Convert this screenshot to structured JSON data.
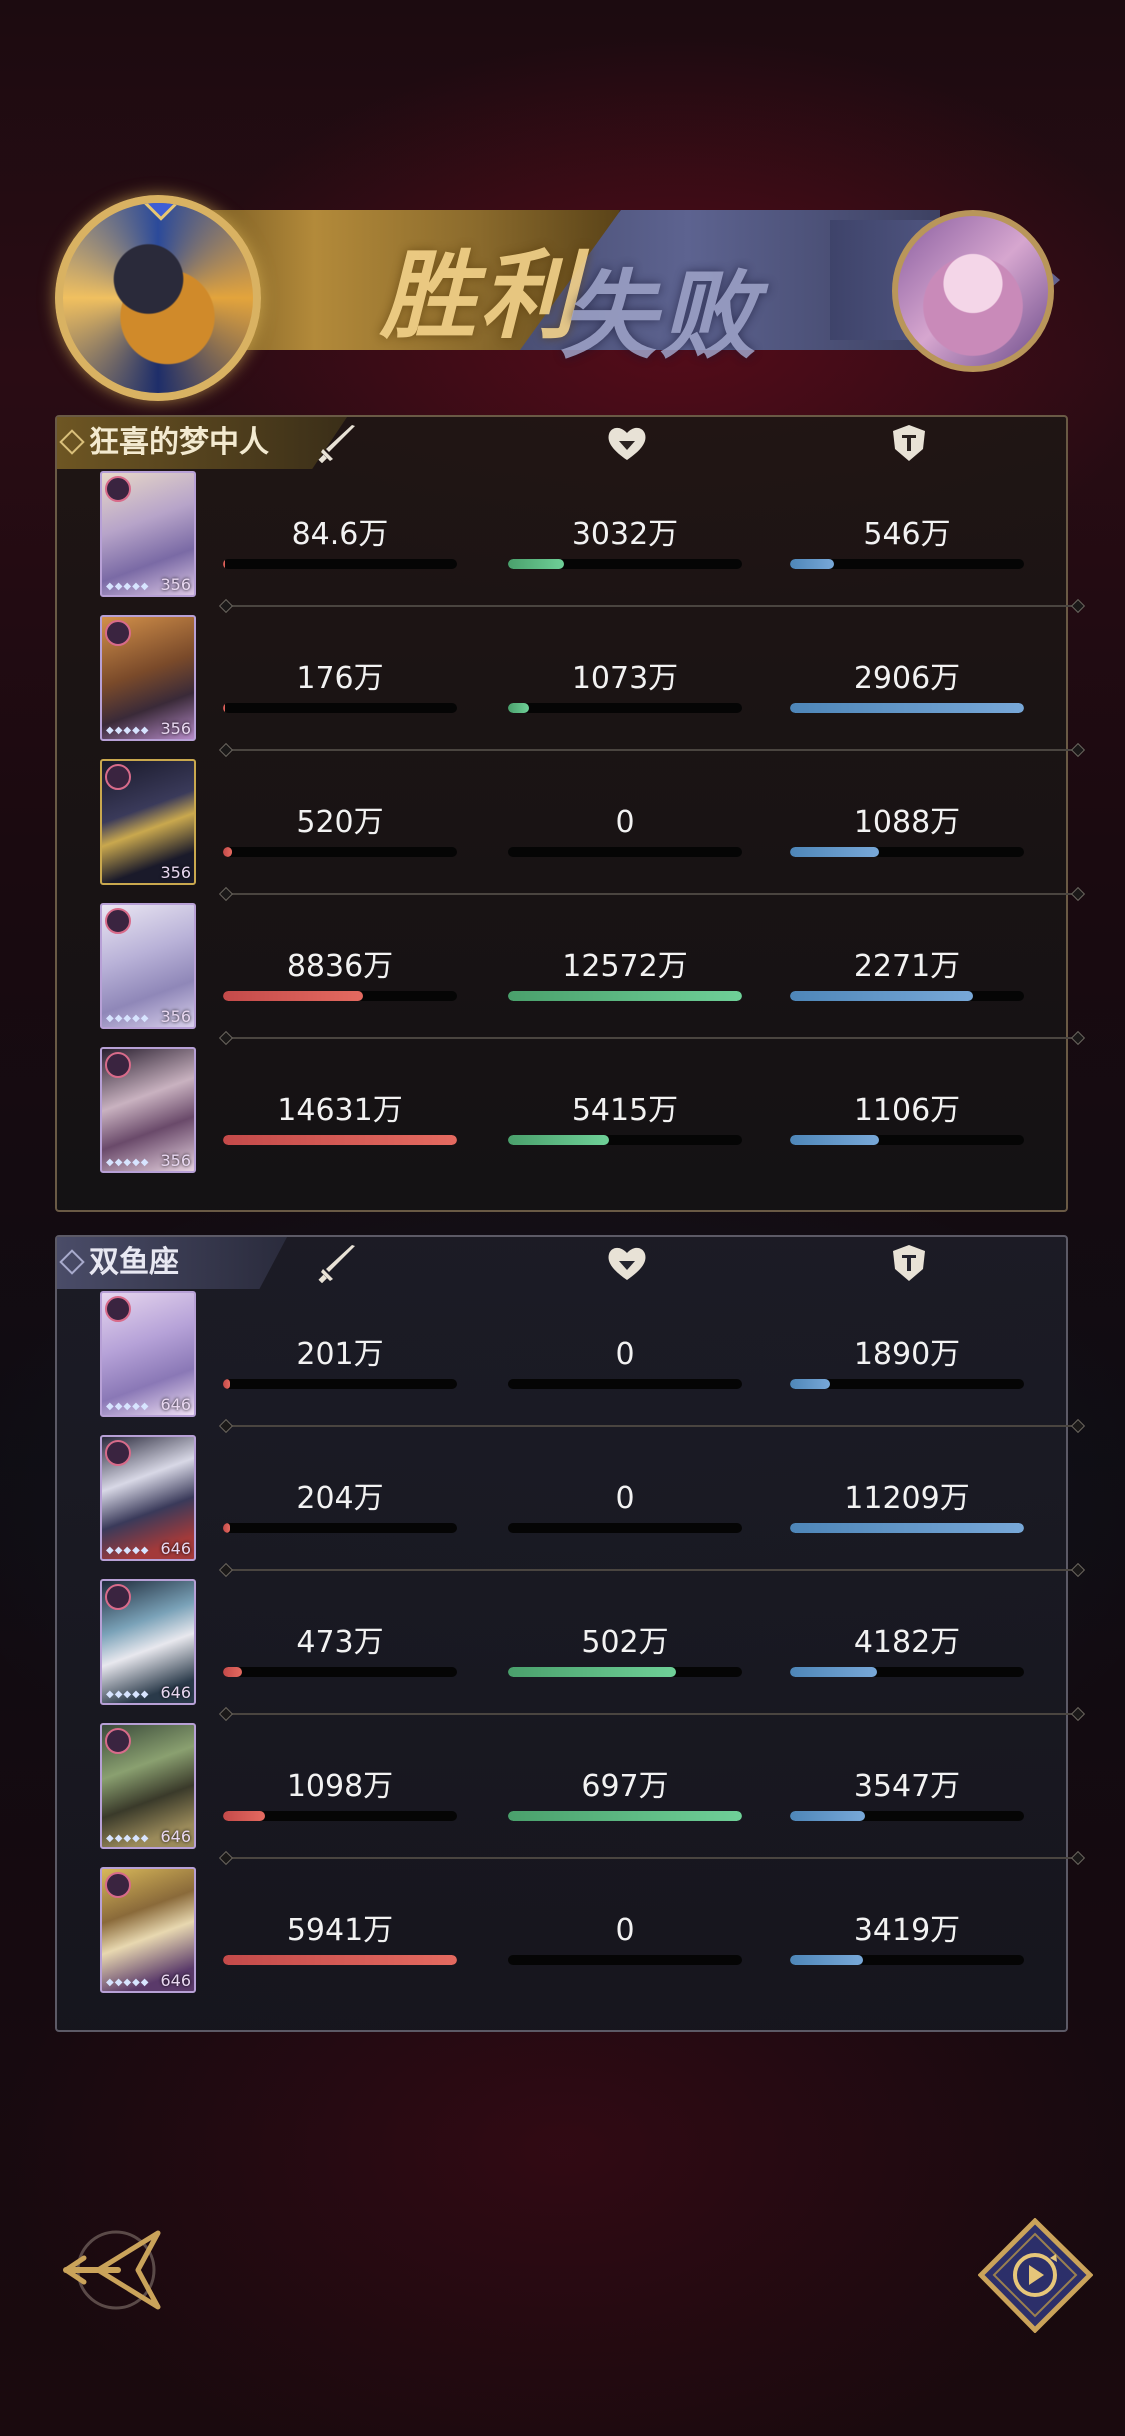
{
  "header": {
    "victory_label": "胜利",
    "defeat_label": "失败"
  },
  "teams": [
    {
      "name": "狂喜的梦中人",
      "result": "victory",
      "members": [
        {
          "level": "356",
          "attack": "84.6万",
          "heal": "3032万",
          "defense": "546万",
          "attack_pct": 1,
          "heal_pct": 24,
          "defense_pct": 19
        },
        {
          "level": "356",
          "attack": "176万",
          "heal": "1073万",
          "defense": "2906万",
          "attack_pct": 1,
          "heal_pct": 9,
          "defense_pct": 100
        },
        {
          "level": "356",
          "attack": "520万",
          "heal": "0",
          "defense": "1088万",
          "attack_pct": 4,
          "heal_pct": 0,
          "defense_pct": 38
        },
        {
          "level": "356",
          "attack": "8836万",
          "heal": "12572万",
          "defense": "2271万",
          "attack_pct": 60,
          "heal_pct": 100,
          "defense_pct": 78
        },
        {
          "level": "356",
          "attack": "14631万",
          "heal": "5415万",
          "defense": "1106万",
          "attack_pct": 100,
          "heal_pct": 43,
          "defense_pct": 38
        }
      ]
    },
    {
      "name": "双鱼座",
      "result": "defeat",
      "members": [
        {
          "level": "646",
          "attack": "201万",
          "heal": "0",
          "defense": "1890万",
          "attack_pct": 3,
          "heal_pct": 0,
          "defense_pct": 17
        },
        {
          "level": "646",
          "attack": "204万",
          "heal": "0",
          "defense": "11209万",
          "attack_pct": 3,
          "heal_pct": 0,
          "defense_pct": 100
        },
        {
          "level": "646",
          "attack": "473万",
          "heal": "502万",
          "defense": "4182万",
          "attack_pct": 8,
          "heal_pct": 72,
          "defense_pct": 37
        },
        {
          "level": "646",
          "attack": "1098万",
          "heal": "697万",
          "defense": "3547万",
          "attack_pct": 18,
          "heal_pct": 100,
          "defense_pct": 32
        },
        {
          "level": "646",
          "attack": "5941万",
          "heal": "0",
          "defense": "3419万",
          "attack_pct": 100,
          "heal_pct": 0,
          "defense_pct": 31
        }
      ]
    }
  ],
  "colors": {
    "attack": "#d9564f",
    "heal": "#5fbf86",
    "defense": "#679bcc",
    "gold": "#caa35a"
  },
  "icons": {
    "attack": "sword-icon",
    "heal": "heart-icon",
    "defense": "shield-icon",
    "back": "back-arrow-icon",
    "replay": "replay-icon"
  }
}
